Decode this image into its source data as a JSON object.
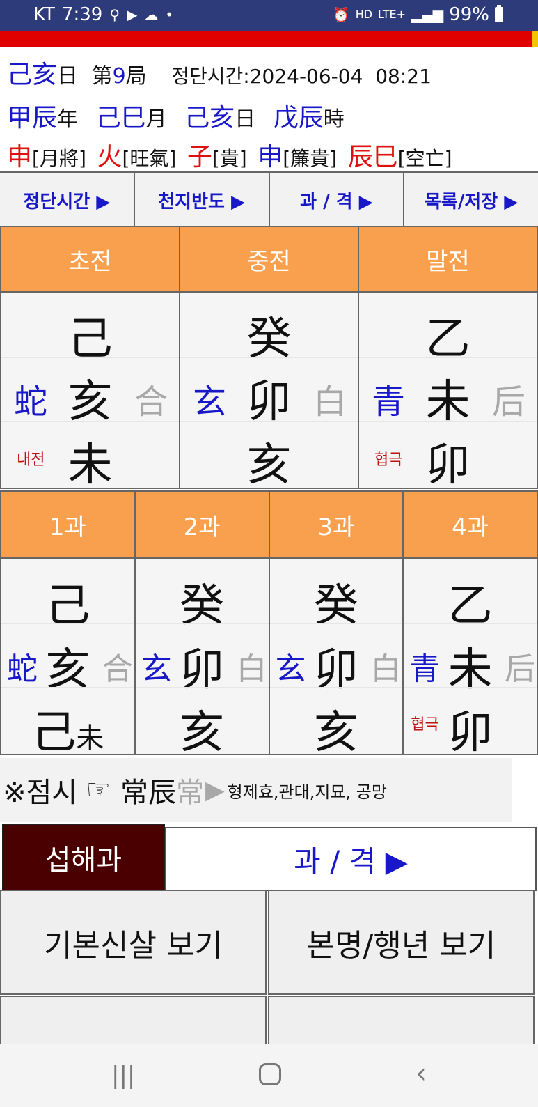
{
  "status_bar": {
    "carrier": "KT",
    "time": "7:39",
    "network": "LTE+",
    "hd": "HD",
    "battery": "99%"
  },
  "header": {
    "line1": {
      "day": "己亥",
      "day_suffix": "日",
      "gu_prefix": "第",
      "gu_num": "9",
      "gu_suffix": "局",
      "time_label": "정단시간:",
      "datetime": "2024-06-04  08:21"
    },
    "line2": [
      {
        "gz": "甲辰",
        "suf": "年"
      },
      {
        "gz": "己巳",
        "suf": "月"
      },
      {
        "gz": "己亥",
        "suf": "日"
      },
      {
        "gz": "戊辰",
        "suf": "時"
      }
    ],
    "line3": [
      {
        "char": "申",
        "label": "[月將]",
        "color": "#e01010"
      },
      {
        "char": "火",
        "label": "[旺氣]",
        "color": "#e01010"
      },
      {
        "char": "子",
        "label": "[貴]",
        "color": "#e01010"
      },
      {
        "char": "申",
        "label": "[簾貴]",
        "color": "#1818c8"
      },
      {
        "char": "辰巳",
        "label": "[空亡]",
        "color": "#e01010"
      }
    ]
  },
  "menu": {
    "btn1": "정단시간 ▶",
    "btn2": "천지반도 ▶",
    "btn3": "과 / 격 ▶",
    "btn4": "목록/저장 ▶"
  },
  "sanjeon": {
    "headers": [
      "초전",
      "중전",
      "말전"
    ],
    "cells": [
      {
        "top": "己",
        "left": "蛇",
        "center": "亥",
        "right": "合",
        "tag": "내전",
        "bottom": "未"
      },
      {
        "top": "癸",
        "left": "玄",
        "center": "卯",
        "right": "白",
        "tag": "",
        "bottom": "亥"
      },
      {
        "top": "乙",
        "left": "青",
        "center": "未",
        "right": "后",
        "tag": "협극",
        "bottom": "卯"
      }
    ]
  },
  "sagwa": {
    "headers": [
      "1과",
      "2과",
      "3과",
      "4과"
    ],
    "cells": [
      {
        "top": "己",
        "left": "蛇",
        "center": "亥",
        "right": "合",
        "tag": "",
        "bottom": "己",
        "suffix": "未"
      },
      {
        "top": "癸",
        "left": "玄",
        "center": "卯",
        "right": "白",
        "tag": "",
        "bottom": "亥",
        "suffix": ""
      },
      {
        "top": "癸",
        "left": "玄",
        "center": "卯",
        "right": "白",
        "tag": "",
        "bottom": "亥",
        "suffix": ""
      },
      {
        "top": "乙",
        "left": "青",
        "center": "未",
        "right": "后",
        "tag": "협극",
        "bottom": "卯",
        "suffix": ""
      }
    ]
  },
  "jeomsi": {
    "prefix": "※점시",
    "hand": "☞",
    "value": "常辰",
    "ghost": "常",
    "arrow": "▶",
    "detail": "형제효,관대,지묘, 공망"
  },
  "bottom": {
    "seophae": "섭해과",
    "gwa_button": "과 / 격 ▶",
    "btn1": "기본신살 보기",
    "btn2": "본명/행년 보기"
  },
  "colors": {
    "status_bar": "#2e3b7a",
    "header_orange": "#f9a04f",
    "accent_blue": "#1818c8",
    "accent_red": "#e01010",
    "seophae_bg": "#4a0000"
  }
}
